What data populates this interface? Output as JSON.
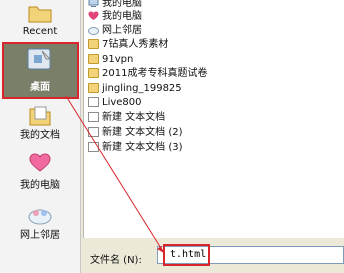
{
  "places": {
    "recent": "Recent",
    "desktop": "桌面",
    "my_documents": "我的文档",
    "my_computer": "我的电脑",
    "network": "网上邻居"
  },
  "files": [
    {
      "name": "我的电脑",
      "icon": "computer-icon"
    },
    {
      "name": "我的电脑",
      "icon": "heart-icon"
    },
    {
      "name": "网上邻居",
      "icon": "network-icon"
    },
    {
      "name": "7钻真人秀素材",
      "icon": "folder-icon"
    },
    {
      "name": "91vpn",
      "icon": "folder-icon"
    },
    {
      "name": "2011成考专科真题试卷",
      "icon": "folder-icon"
    },
    {
      "name": "jingling_199825",
      "icon": "folder-icon"
    },
    {
      "name": "Live800",
      "icon": "document-icon"
    },
    {
      "name": "新建 文本文档",
      "icon": "document-icon"
    },
    {
      "name": "新建 文本文档 (2)",
      "icon": "document-icon"
    },
    {
      "name": "新建 文本文档 (3)",
      "icon": "document-icon"
    }
  ],
  "filename": {
    "label": "文件名 (N):",
    "value": "t.html"
  },
  "colors": {
    "highlight": "#d8262c",
    "folder": "#f3d37a"
  }
}
